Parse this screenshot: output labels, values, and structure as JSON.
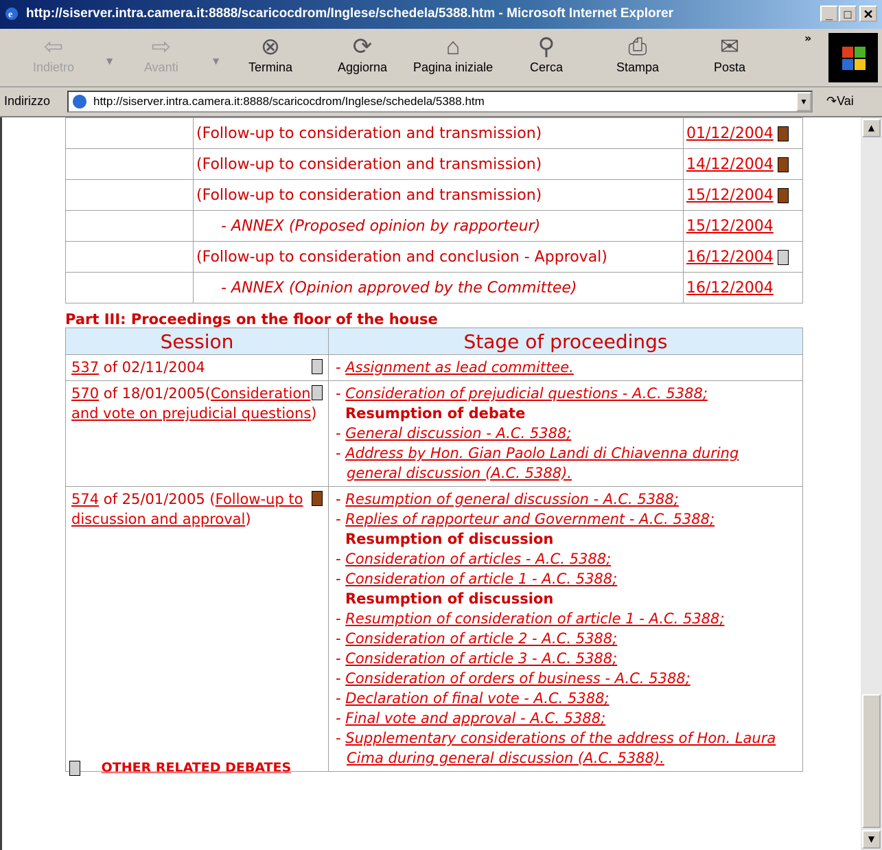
{
  "window": {
    "title": "http://siserver.intra.camera.it:8888/scaricocdrom/Inglese/schedela/5388.htm - Microsoft Internet Explorer",
    "min": "_",
    "max": "□",
    "close": "✕"
  },
  "toolbar": {
    "back": "Indietro",
    "forward": "Avanti",
    "stop": "Termina",
    "refresh": "Aggiorna",
    "home": "Pagina iniziale",
    "search": "Cerca",
    "print": "Stampa",
    "mail": "Posta",
    "more": "»"
  },
  "address": {
    "label": "Indirizzo",
    "url": "http://siserver.intra.camera.it:8888/scaricocdrom/Inglese/schedela/5388.htm",
    "go": "Vai"
  },
  "committee_rows": [
    {
      "text": "(Follow-up to consideration and transmission)",
      "date": "01/12/2004",
      "italic": false,
      "icon": "brown"
    },
    {
      "text": "(Follow-up to consideration and transmission)",
      "date": "14/12/2004",
      "italic": false,
      "icon": "brown"
    },
    {
      "text": "(Follow-up to consideration and transmission)",
      "date": "15/12/2004",
      "italic": false,
      "icon": "brown"
    },
    {
      "text": "- ANNEX (Proposed opinion by rapporteur)",
      "date": "15/12/2004",
      "italic": true,
      "icon": ""
    },
    {
      "text": "(Follow-up to consideration and conclusion - Approval)",
      "date": "16/12/2004",
      "italic": false,
      "icon": "gray"
    },
    {
      "text": "- ANNEX (Opinion approved by the Committee)",
      "date": "16/12/2004",
      "italic": true,
      "icon": ""
    }
  ],
  "part3": {
    "heading": "Part III: Proceedings on the floor of the house",
    "col_session": "Session",
    "col_stage": "Stage of proceedings"
  },
  "sessions": [
    {
      "num": "537",
      "date": " of 02/11/2004",
      "desc_link": "",
      "desc_pre": "",
      "desc_post": "",
      "icon": "gray",
      "stages": [
        {
          "type": "link",
          "text": "Assignment as lead committee."
        }
      ]
    },
    {
      "num": "570",
      "date": " of 18/01/2005",
      "desc_pre": "(",
      "desc_link": "Consideration and vote on prejudicial questions",
      "desc_post": ")",
      "icon": "gray",
      "stages": [
        {
          "type": "link",
          "text": "Consideration of prejudicial questions - A.C. 5388;"
        },
        {
          "type": "head",
          "text": "Resumption of debate"
        },
        {
          "type": "link",
          "text": "General discussion - A.C. 5388;"
        },
        {
          "type": "link",
          "text": "Address by Hon. Gian Paolo Landi di Chiavenna during general discussion (A.C. 5388)."
        }
      ]
    },
    {
      "num": "574",
      "date": " of 25/01/2005",
      "desc_pre": " (",
      "desc_link": "Follow-up to discussion and approval",
      "desc_post": ")",
      "icon": "brown",
      "stages": [
        {
          "type": "link",
          "text": "Resumption of general discussion - A.C. 5388;"
        },
        {
          "type": "link",
          "text": "Replies of rapporteur and Government - A.C. 5388;"
        },
        {
          "type": "head",
          "text": "Resumption of discussion"
        },
        {
          "type": "link",
          "text": "Consideration of articles - A.C. 5388;"
        },
        {
          "type": "link",
          "text": "Consideration of article 1 - A.C. 5388;"
        },
        {
          "type": "head",
          "text": "Resumption of discussion"
        },
        {
          "type": "link",
          "text": "Resumption of consideration of article 1 - A.C. 5388;"
        },
        {
          "type": "link",
          "text": "Consideration of article 2 - A.C. 5388;"
        },
        {
          "type": "link",
          "text": "Consideration of article 3 - A.C. 5388;"
        },
        {
          "type": "link",
          "text": "Consideration of orders of business - A.C. 5388;"
        },
        {
          "type": "link",
          "text": "Declaration of final vote - A.C. 5388;"
        },
        {
          "type": "link",
          "text": "Final vote and approval - A.C. 5388;"
        },
        {
          "type": "link",
          "text": "Supplementary considerations of the address of Hon. Laura Cima during general discussion (A.C. 5388)."
        }
      ]
    }
  ],
  "other_related": "OTHER RELATED DEBATES",
  "colors": {
    "link_red": "#e00000",
    "header_bg": "#d9eefa",
    "title_bar": "#0a246a"
  }
}
